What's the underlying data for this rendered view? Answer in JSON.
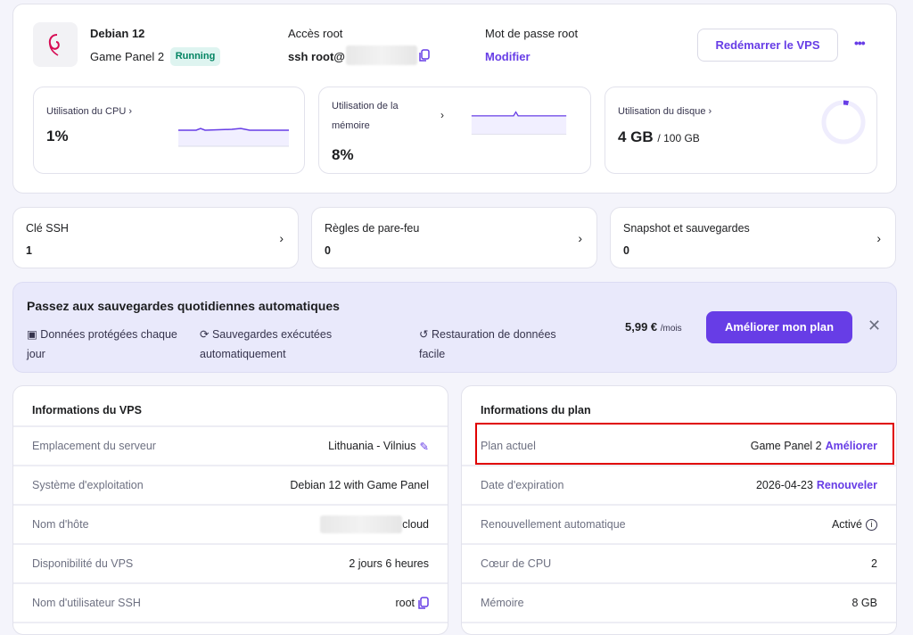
{
  "server": {
    "os": "Debian 12",
    "plan": "Game Panel 2",
    "status": "Running",
    "root_access_label": "Accès root",
    "root_access_cmd": "ssh root@",
    "root_password_label": "Mot de passe root",
    "modify": "Modifier",
    "restart": "Redémarrer le VPS",
    "more": "•••"
  },
  "metrics": {
    "cpu_label": "Utilisation du CPU",
    "cpu_value": "1%",
    "memory_label_1": "Utilisation de la",
    "memory_label_2": "mémoire",
    "memory_value": "8%",
    "disk_label": "Utilisation du disque",
    "disk_used": "4 GB",
    "disk_total": "/ 100 GB",
    "disk_fraction": 0.04
  },
  "shortcuts": [
    {
      "title": "Clé SSH",
      "value": "1"
    },
    {
      "title": "Règles de pare-feu",
      "value": "0"
    },
    {
      "title": "Snapshot et sauvegardes",
      "value": "0"
    }
  ],
  "banner": {
    "title": "Passez aux sauvegardes quotidiennes automatiques",
    "f1a": "Données protégées chaque",
    "f1b": "jour",
    "f2a": "Sauvegardes exécutées",
    "f2b": "automatiquement",
    "f3a": "Restauration de données",
    "f3b": "facile",
    "price": "5,99 €",
    "per": "/mois",
    "cta": "Améliorer mon plan"
  },
  "vps_info": {
    "title": "Informations du VPS",
    "rows": [
      {
        "k": "Emplacement du serveur",
        "v": "Lithuania - Vilnius"
      },
      {
        "k": "Système d'exploitation",
        "v": "Debian 12 with Game Panel"
      },
      {
        "k": "Nom d'hôte",
        "v": "cloud"
      },
      {
        "k": "Disponibilité du VPS",
        "v": "2 jours 6 heures"
      },
      {
        "k": "Nom d'utilisateur SSH",
        "v": "root"
      }
    ]
  },
  "plan_info": {
    "title": "Informations du plan",
    "rows": [
      {
        "k": "Plan actuel",
        "v": "Game Panel 2",
        "link": "Améliorer"
      },
      {
        "k": "Date d'expiration",
        "v": "2026-04-23",
        "link": "Renouveler"
      },
      {
        "k": "Renouvellement automatique",
        "v": "Activé"
      },
      {
        "k": "Cœur de CPU",
        "v": "2"
      },
      {
        "k": "Mémoire",
        "v": "8 GB"
      }
    ]
  }
}
